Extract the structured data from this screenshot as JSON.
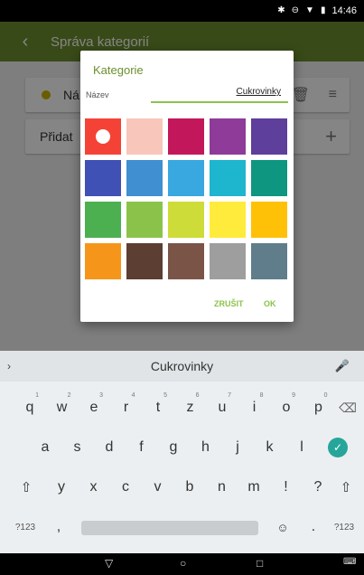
{
  "status": {
    "bt_icon": "bluetooth-icon",
    "dnd_icon": "minus-circle-icon",
    "wifi_icon": "wifi-icon",
    "battery_icon": "battery-icon",
    "time": "14:46"
  },
  "toolbar": {
    "back_icon": "arrow-back-icon",
    "title": "Správa kategorií"
  },
  "list": {
    "item1": {
      "dot_color": "#c9b200",
      "label": "Ná",
      "trash_icon": "trash-icon",
      "menu_icon": "drag-handle-icon"
    },
    "item2": {
      "label": "Přidat",
      "plus_icon": "plus-icon"
    }
  },
  "dialog": {
    "title": "Kategorie",
    "name_label": "Název",
    "name_value": "Cukrovinky",
    "accent_color": "#8bc34a",
    "title_color": "#6b8f2e",
    "colors": [
      "#f44336",
      "#f8c6bb",
      "#c2185b",
      "#8e3b9a",
      "#5e3f9c",
      "#3f51b5",
      "#3f8fd1",
      "#39a7e0",
      "#1eb5cf",
      "#0f9680",
      "#4caf50",
      "#8bc34a",
      "#cddc39",
      "#ffeb3b",
      "#ffc107",
      "#f5961b",
      "#5d3e33",
      "#7b5448",
      "#9e9e9e",
      "#607d8b"
    ],
    "selected_index": 0,
    "cancel_label": "ZRUŠIT",
    "ok_label": "OK"
  },
  "keyboard": {
    "suggestion": "Cukrovinky",
    "expand_icon": "chevron-right-icon",
    "mic_icon": "microphone-icon",
    "row1": [
      "q",
      "w",
      "e",
      "r",
      "t",
      "z",
      "u",
      "i",
      "o",
      "p"
    ],
    "row1_hints": [
      "1",
      "2",
      "3",
      "4",
      "5",
      "6",
      "7",
      "8",
      "9",
      "0"
    ],
    "backspace_icon": "backspace-icon",
    "row2": [
      "a",
      "s",
      "d",
      "f",
      "g",
      "h",
      "j",
      "k",
      "l"
    ],
    "enter_icon": "checkmark-icon",
    "shift_icon": "shift-icon",
    "row3": [
      "y",
      "x",
      "c",
      "v",
      "b",
      "n",
      "m",
      "!",
      "?"
    ],
    "symbols_label": "?123",
    "comma": ",",
    "emoji_icon": "emoji-icon",
    "period": "."
  },
  "navbar": {
    "back_icon": "nav-back-icon",
    "home_icon": "home-icon",
    "recents_icon": "recents-icon",
    "keyboard_icon": "keyboard-icon"
  }
}
